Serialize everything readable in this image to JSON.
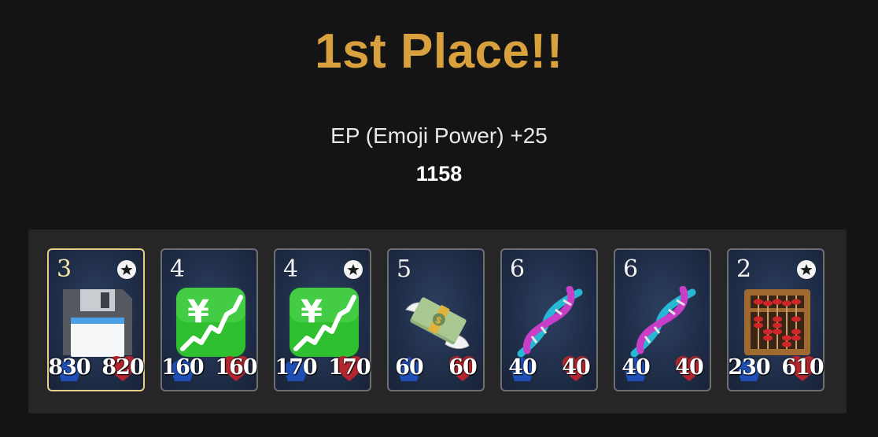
{
  "result": {
    "title": "1st Place!!",
    "ep_label": "EP (Emoji Power) +25",
    "ep_total": "1158"
  },
  "cards": [
    {
      "cost": "3",
      "starred": true,
      "selected": true,
      "emoji": "floppy-disk",
      "attack": "830",
      "health": "820"
    },
    {
      "cost": "4",
      "starred": false,
      "selected": false,
      "emoji": "chart-yen",
      "attack": "160",
      "health": "160"
    },
    {
      "cost": "4",
      "starred": true,
      "selected": false,
      "emoji": "chart-yen",
      "attack": "170",
      "health": "170"
    },
    {
      "cost": "5",
      "starred": false,
      "selected": false,
      "emoji": "money-with-wings",
      "attack": "60",
      "health": "60"
    },
    {
      "cost": "6",
      "starred": false,
      "selected": false,
      "emoji": "dna",
      "attack": "40",
      "health": "40"
    },
    {
      "cost": "6",
      "starred": false,
      "selected": false,
      "emoji": "dna",
      "attack": "40",
      "health": "40"
    },
    {
      "cost": "2",
      "starred": true,
      "selected": false,
      "emoji": "abacus",
      "attack": "230",
      "health": "610"
    }
  ],
  "colors": {
    "title": "#d9a13d",
    "attack_badge": "#1f4fb3",
    "health_badge": "#b3262e",
    "selected_border": "#e7cf8a"
  }
}
